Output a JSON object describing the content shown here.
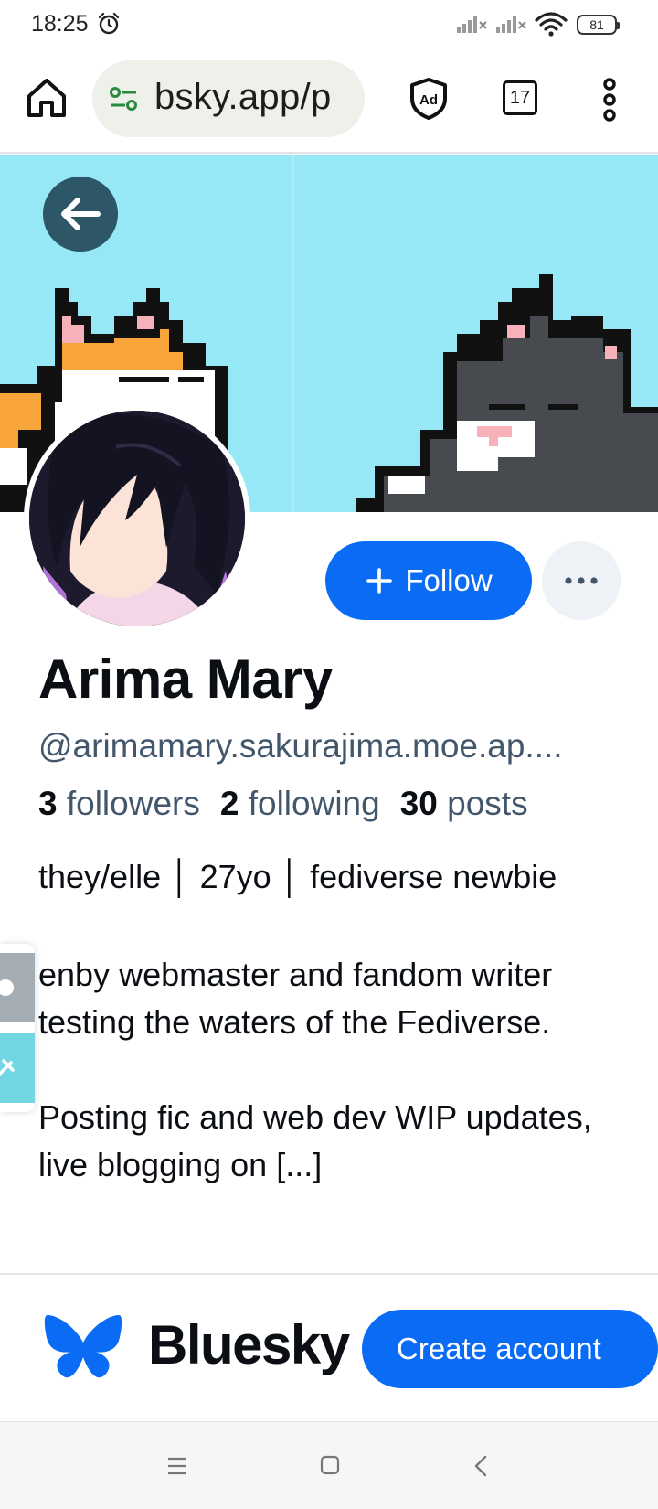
{
  "status_bar": {
    "time": "18:25",
    "battery": "81"
  },
  "browser": {
    "url": "bsky.app/p",
    "tab_count": "17"
  },
  "profile": {
    "display_name": "Arima Mary",
    "handle": "@arimamary.sakurajima.moe.ap....",
    "followers_count": "3",
    "followers_label": "followers",
    "following_count": "2",
    "following_label": "following",
    "posts_count": "30",
    "posts_label": "posts",
    "pronouns_line": "they/elle │ 27yo │ fediverse newbie",
    "bio_paragraph_1": "enby webmaster and fandom writer testing the waters of the Fediverse.",
    "bio_paragraph_2": "Posting fic and web dev WIP updates, live blogging on [...]"
  },
  "actions": {
    "follow_label": "Follow",
    "more_label": "···"
  },
  "footer": {
    "brand": "Bluesky",
    "create_account_label": "Create account"
  },
  "colors": {
    "accent": "#0a6cf5",
    "banner_sky": "#97e8f7",
    "muted_text": "#42576c"
  },
  "icons": [
    "alarm-icon",
    "signal-icon",
    "wifi-icon",
    "home-icon",
    "tune-icon",
    "adblock-icon",
    "more-vert-icon",
    "back-arrow-icon",
    "plus-icon",
    "ellipsis-icon",
    "butterfly-icon",
    "menu-lines-icon",
    "square-icon",
    "chevron-left-icon"
  ]
}
